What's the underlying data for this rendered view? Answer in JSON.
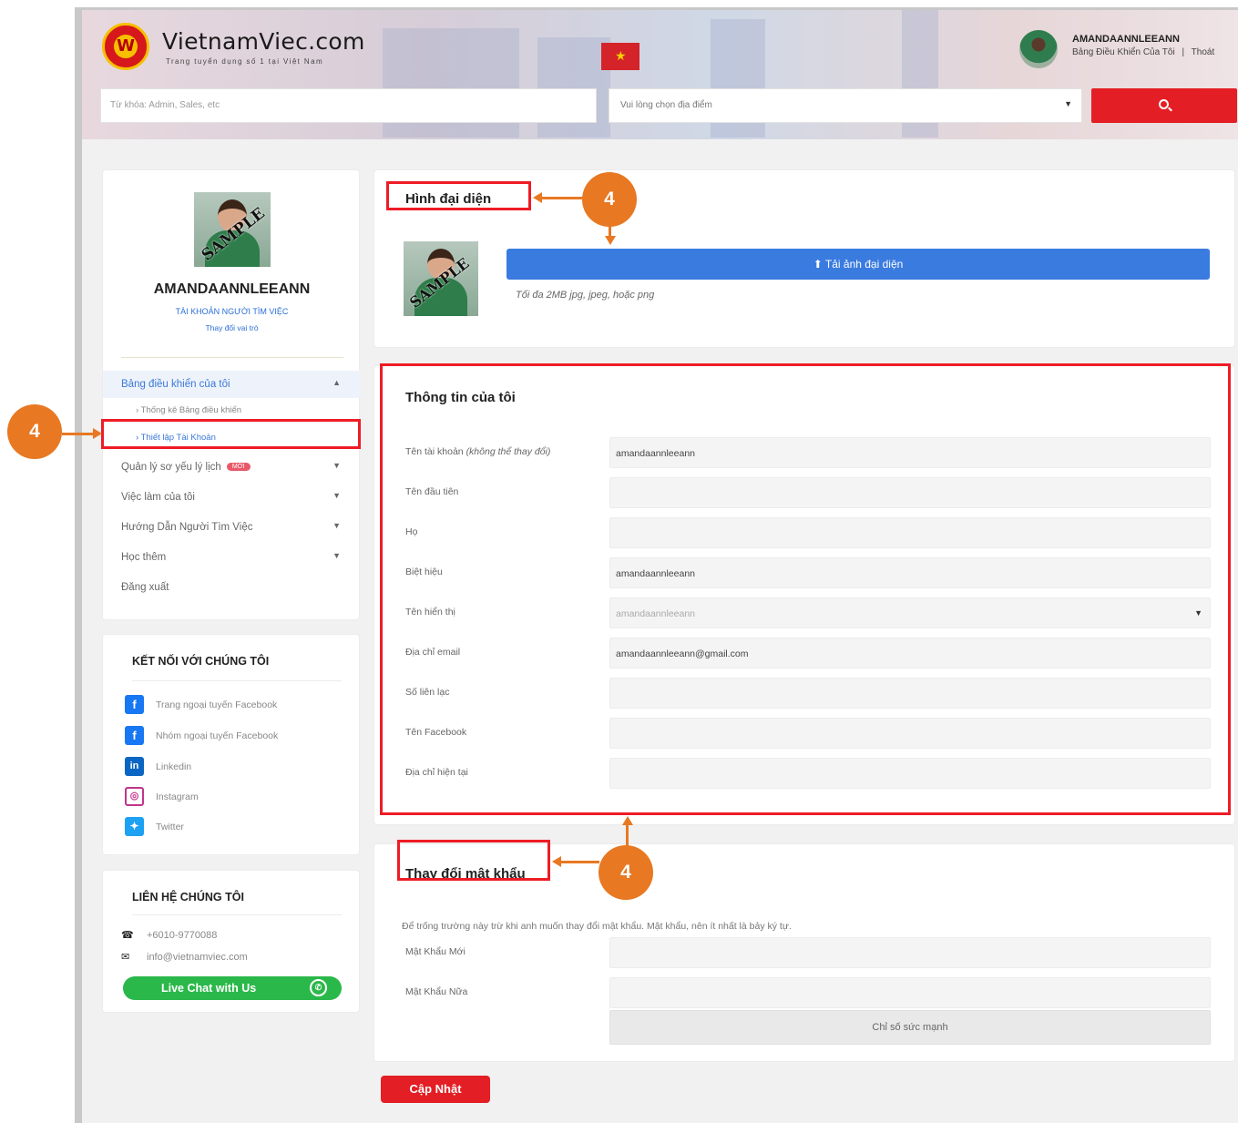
{
  "header": {
    "logo_name": "VietnamViec.com",
    "logo_tagline": "Trang tuyển dụng số 1 tại Việt Nam",
    "user_name": "AMANDAANNLEEANN",
    "dashboard_link": "Bảng Điều Khiển Của Tôi",
    "link_separator": "|",
    "logout_link": "Thoát",
    "search_placeholder": "Từ khóa: Admin, Sales, etc",
    "location_placeholder": "Vui lòng chọn địa điểm"
  },
  "sidebar": {
    "profile_name": "AMANDAANNLEEANN",
    "account_type": "TÀI KHOẢN NGƯỜI TÌM VIỆC",
    "change_role": "Thay đổi vai trò",
    "avatar_watermark": "SAMPLE",
    "menu": [
      {
        "label": "Bảng điều khiển của tôi"
      },
      {
        "label": "Quản lý sơ yếu lý lịch",
        "badge": "MỚI"
      },
      {
        "label": "Việc làm của tôi"
      },
      {
        "label": "Hướng Dẫn Người Tìm Việc"
      },
      {
        "label": "Học thêm"
      },
      {
        "label": "Đăng xuất"
      }
    ],
    "submenu": [
      "Thống kê Bảng điều khiển",
      "Thiết lập Tài Khoản"
    ]
  },
  "connect": {
    "title": "KẾT NỐI VỚI CHÚNG TÔI",
    "items": [
      {
        "label": "Trang ngoại tuyến Facebook",
        "icon": "facebook-icon"
      },
      {
        "label": "Nhóm ngoại tuyến Facebook",
        "icon": "facebook-group-icon"
      },
      {
        "label": "Linkedin",
        "icon": "linkedin-icon"
      },
      {
        "label": "Instagram",
        "icon": "instagram-icon"
      },
      {
        "label": "Twitter",
        "icon": "twitter-icon"
      }
    ]
  },
  "contact": {
    "title": "LIÊN HỆ CHÚNG TÔI",
    "phone": "+6010-9770088",
    "email": "info@vietnamviec.com",
    "live_chat": "Live Chat with Us"
  },
  "avatar_section": {
    "title": "Hình đại diện",
    "upload_button": "Tải ảnh đại diện",
    "hint": "Tối đa 2MB jpg, jpeg, hoặc png"
  },
  "info_section": {
    "title": "Thông tin của tôi",
    "fields": [
      {
        "label": "Tên tài khoản",
        "note": "(không thể thay đổi)",
        "value": "amandaannleeann"
      },
      {
        "label": "Tên đầu tiên",
        "value": ""
      },
      {
        "label": "Họ",
        "value": ""
      },
      {
        "label": "Biệt hiệu",
        "value": "amandaannleeann"
      },
      {
        "label": "Tên hiển thị",
        "value": "amandaannleeann"
      },
      {
        "label": "Địa chỉ email",
        "value": "amandaannleeann@gmail.com"
      },
      {
        "label": "Số liên lạc",
        "value": ""
      },
      {
        "label": "Tên Facebook",
        "value": ""
      },
      {
        "label": "Địa chỉ hiện tại",
        "value": ""
      }
    ]
  },
  "password_section": {
    "title": "Thay đổi mật khẩu",
    "note": "Để trống trường này trừ khi anh muốn thay đổi mật khẩu. Mật khẩu, nên ít nhất là bảy ký tự.",
    "new_password_label": "Mật Khẩu Mới",
    "repeat_password_label": "Mật Khẩu Nữa",
    "strength_label": "Chỉ số sức mạnh"
  },
  "update_button": "Cập Nhật",
  "annotations": {
    "callout_number": "4",
    "color": "#e87822",
    "highlight_color": "#ee1c25"
  }
}
